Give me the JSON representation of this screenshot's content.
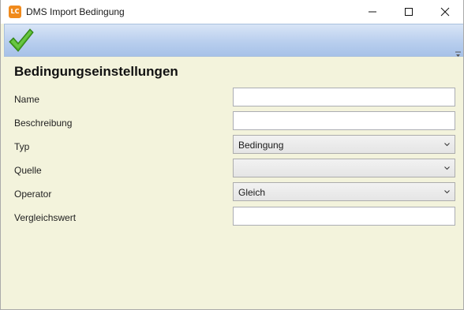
{
  "window": {
    "icon_text": "LC",
    "title": "DMS Import Bedingung"
  },
  "ribbon": {
    "ok_icon": "checkmark-icon"
  },
  "form": {
    "heading": "Bedingungseinstellungen",
    "name_label": "Name",
    "name_value": "",
    "beschreibung_label": "Beschreibung",
    "beschreibung_value": "",
    "typ_label": "Typ",
    "typ_value": "Bedingung",
    "quelle_label": "Quelle",
    "quelle_value": "",
    "operator_label": "Operator",
    "operator_value": "Gleich",
    "vergleichswert_label": "Vergleichswert",
    "vergleichswert_value": ""
  },
  "colors": {
    "accent_check": "#4caf24",
    "background": "#f3f3dc",
    "ribbon": "#b9cfee"
  }
}
